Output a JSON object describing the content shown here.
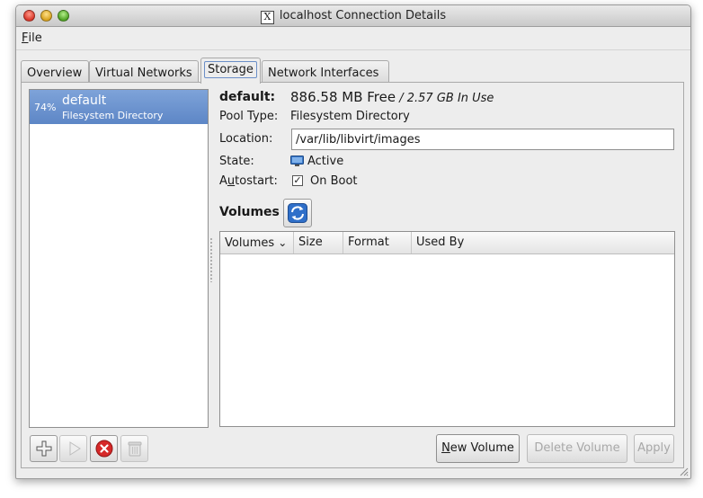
{
  "window": {
    "title": "localhost Connection Details",
    "x_badge": "X"
  },
  "menu": {
    "file_first": "F",
    "file_rest": "ile"
  },
  "tabs": [
    {
      "label": "Overview"
    },
    {
      "label": "Virtual Networks"
    },
    {
      "label": "Storage"
    },
    {
      "label": "Network Interfaces"
    }
  ],
  "pool_list": {
    "items": [
      {
        "percent": "74%",
        "name": "default",
        "type": "Filesystem Directory"
      }
    ]
  },
  "details": {
    "name_label": "default:",
    "free": "886.58 MB Free",
    "in_use": " / 2.57 GB In Use",
    "pool_type_label": "Pool Type:",
    "pool_type_value": "Filesystem Directory",
    "location_label": "Location:",
    "location_value": "/var/lib/libvirt/images",
    "state_label": "State:",
    "state_value": "Active",
    "autostart_label_pre": "A",
    "autostart_label_u": "u",
    "autostart_label_post": "tostart:",
    "autostart_value": "On Boot",
    "autostart_checked": "✓",
    "volumes_label": "Volumes"
  },
  "volumes_table": {
    "columns": [
      "Volumes",
      "Size",
      "Format",
      "Used By"
    ],
    "sort_indicator": "⌄"
  },
  "buttons": {
    "new_volume_u": "N",
    "new_volume_rest": "ew Volume",
    "delete_volume": "Delete Volume",
    "apply": "Apply"
  },
  "colors": {
    "selection": "#5d86c6",
    "delete_red": "#d62828",
    "refresh_blue": "#2f6fc9"
  }
}
